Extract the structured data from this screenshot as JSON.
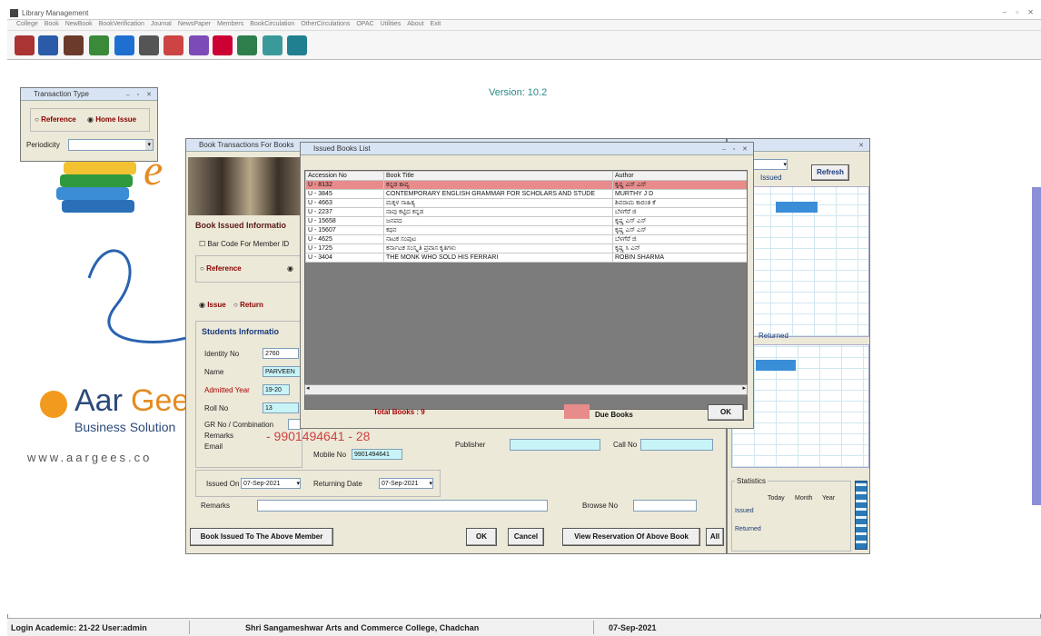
{
  "app": {
    "title": "Library Management",
    "menus": [
      "College",
      "Book",
      "NewBook",
      "BookVerification",
      "Journal",
      "NewsPaper",
      "Members",
      "BookCirculation",
      "OtherCirculations",
      "OPAC",
      "Utilities",
      "About",
      "Exit"
    ]
  },
  "main": {
    "version": "Version: 10.2",
    "brand": {
      "name_a": "Aar",
      "name_b": "Gees",
      "tagline": "Business Solution",
      "website": "www.aargees.co"
    }
  },
  "transaction_type": {
    "title": "Transaction Type",
    "opt_reference": "Reference",
    "opt_home_issue": "Home Issue",
    "periodicity_label": "Periodicity"
  },
  "book_transaction": {
    "title": "Book Transactions For Books",
    "section_title": "Book Issued Informatio",
    "barcode_label": "Bar Code For Member ID",
    "opt_reference": "Reference",
    "opt_issue": "Issue",
    "opt_return": "Return",
    "students_title": "Students Informatio",
    "identity_label": "Identity No",
    "identity_value": "2760",
    "name_label": "Name",
    "name_value": "PARVEEN",
    "admitted_label": "Admitted Year",
    "admitted_value": "19-20",
    "roll_label": "Roll No",
    "roll_value": "13",
    "gr_label": "GR No / Combination",
    "remarks_label": "Remarks",
    "phone_overlay": "- 9901494641 - 28",
    "email_label": "Email",
    "mobile_label": "Mobile No",
    "mobile_value": "9901494641",
    "publisher_label": "Publisher",
    "callno_label": "Call No",
    "issued_on_label": "Issued On",
    "issued_on_value": "07-Sep-2021",
    "returning_label": "Returning Date",
    "returning_value": "07-Sep-2021",
    "remarks2_label": "Remarks",
    "browse_label": "Browse No",
    "btn_issued": "Book Issued To The Above Member",
    "btn_ok": "OK",
    "btn_cancel": "Cancel",
    "btn_view": "View Reservation Of Above Book",
    "btn_all": "All"
  },
  "issued_list": {
    "title": "Issued Books List",
    "headers": [
      "Accession No",
      "Book Title",
      "Author"
    ],
    "rows": [
      [
        "U - 8132",
        "ಕನ್ನಡ ಕಾವ್ಯ",
        "ಕೃಷ್ಣ ಎಸ್ ಎಸ್"
      ],
      [
        "U - 3845",
        "CONTEMPORARY ENGLISH GRAMMAR FOR SCHOLARS AND STUDE",
        "MURTHY J D"
      ],
      [
        "U - 4663",
        "ಮಕ್ಕಳ ಸಾಹಿತ್ಯ",
        "ಶಿವರಾಮ ಕಾರಂತ ಕೆ"
      ],
      [
        "U - 2237",
        "ನಾವು ಕಟ್ಟಿದ ಕನ್ನಡ",
        "ಬೆಳಗೆರೆ ಜಿ"
      ],
      [
        "U - 15658",
        "ಜನಪದ",
        "ಕೃಷ್ಣ ಎಸ್ ಎಸ್"
      ],
      [
        "U - 15607",
        "ಕಥನ",
        "ಕೃಷ್ಣ ಎಸ್ ಎಸ್"
      ],
      [
        "U - 4625",
        "ನಾಟಕ ಸಂಪುಟ",
        "ಬೆಳಗೆರೆ ಜಿ"
      ],
      [
        "U - 1725",
        "ಕರ್ನಾಟಕ ಸಂಸ್ಕೃತಿ ಪ್ರವಾಸ ಕೃತಿಗಳು",
        "ಕೃಷ್ಣ ಸಿ ಎನ್"
      ],
      [
        "U - 3404",
        "THE MONK WHO SOLD HIS FERRARI",
        "ROBIN SHARMA"
      ]
    ],
    "total_label": "Total Books : 9",
    "due_label": "Due Books",
    "btn_ok": "OK",
    "due_color": "#e88b8b"
  },
  "side_panel": {
    "refresh": "Refresh",
    "issued": "Issued",
    "returned": "Returned",
    "statistics": "Statistics",
    "cols": [
      "Today",
      "Month",
      "Year"
    ],
    "rows": [
      "Issued",
      "Returned"
    ]
  },
  "statusbar": {
    "left": "Login Academic: 21-22  User:admin",
    "center": "Shri Sangameshwar Arts and Commerce College, Chadchan",
    "date": "07-Sep-2021"
  }
}
